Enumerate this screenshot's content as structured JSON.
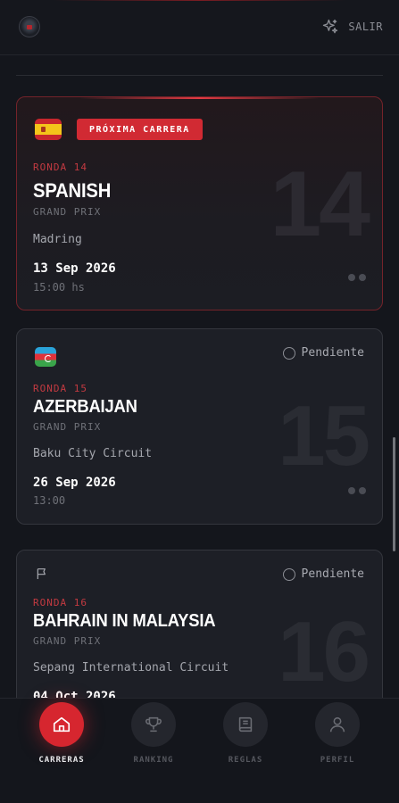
{
  "header": {
    "logout_label": "SALIR",
    "logo_icon": "team-badge-logo",
    "logout_icon": "sparkle-logout-icon"
  },
  "races": [
    {
      "highlight": true,
      "badge": "PRÓXIMA CARRERA",
      "flag_icon": "flag-spain",
      "round": "RONDA 14",
      "name": "SPANISH",
      "subtitle": "GRAND PRIX",
      "circuit": "Madring",
      "date": "13 Sep 2026",
      "time": "15:00 hs",
      "number": "14"
    },
    {
      "highlight": false,
      "status": "Pendiente",
      "flag_icon": "flag-azerbaijan",
      "round": "RONDA 15",
      "name": "AZERBAIJAN",
      "subtitle": "GRAND PRIX",
      "circuit": "Baku City Circuit",
      "date": "26 Sep 2026",
      "time": "13:00",
      "number": "15"
    },
    {
      "highlight": false,
      "status": "Pendiente",
      "flag_icon": "flag-outline-icon",
      "round": "RONDA 16",
      "name": "BAHRAIN IN MALAYSIA",
      "subtitle": "GRAND PRIX",
      "circuit": "Sepang International Circuit",
      "date": "04 Oct 2026",
      "number": "16"
    }
  ],
  "nav": {
    "items": [
      {
        "label": "CARRERAS",
        "icon": "home-icon",
        "active": true
      },
      {
        "label": "RANKING",
        "icon": "trophy-icon",
        "active": false
      },
      {
        "label": "REGLAS",
        "icon": "book-icon",
        "active": false
      },
      {
        "label": "PERFIL",
        "icon": "user-icon",
        "active": false
      }
    ]
  },
  "colors": {
    "accent": "#d6262f",
    "background": "#14161c",
    "card": "#1d1f26"
  }
}
